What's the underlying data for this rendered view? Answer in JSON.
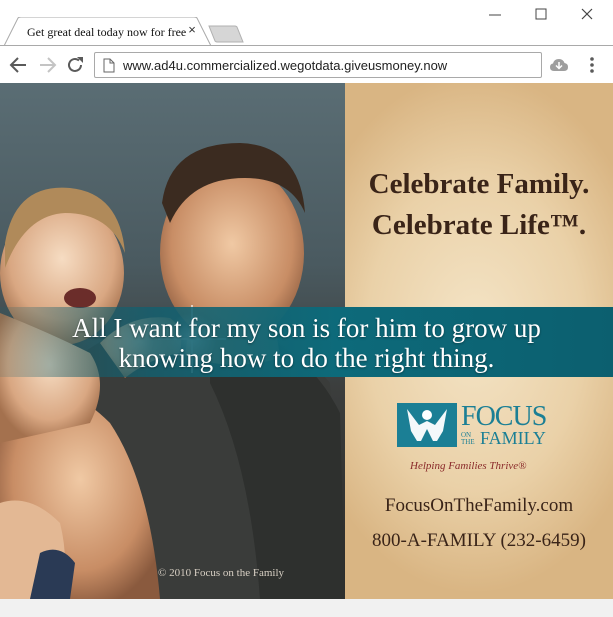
{
  "tab": {
    "title": "Get great deal today now for free",
    "close_symbol": "×"
  },
  "toolbar": {
    "url": "www.ad4u.commercialized.wegotdata.giveusmoney.now"
  },
  "icons": {
    "back": "back-arrow-icon",
    "forward": "forward-arrow-icon",
    "reload": "reload-icon",
    "page": "page-icon",
    "extension": "extension-icon",
    "menu": "kebab-menu-icon",
    "minimize": "minimize-icon",
    "maximize": "maximize-icon",
    "close": "close-icon"
  },
  "ad": {
    "headline_1": "Celebrate Family.",
    "headline_2": "Celebrate Life™.",
    "banner_line_1": "All I want for my son is for him to grow up",
    "banner_line_2": "knowing how to do the right thing.",
    "logo": {
      "focus": "FOCUS",
      "on_the": "ON THE",
      "family": "FAMILY"
    },
    "tagline": "Helping Families Thrive®",
    "website": "FocusOnTheFamily.com",
    "phone": "800-A-FAMILY (232-6459)",
    "copyright": "© 2010 Focus on the Family"
  },
  "colors": {
    "banner": "#0d6a7a",
    "logo": "#1b7f95",
    "text_brown": "#3a2418",
    "tagline": "#8a2a2a"
  }
}
